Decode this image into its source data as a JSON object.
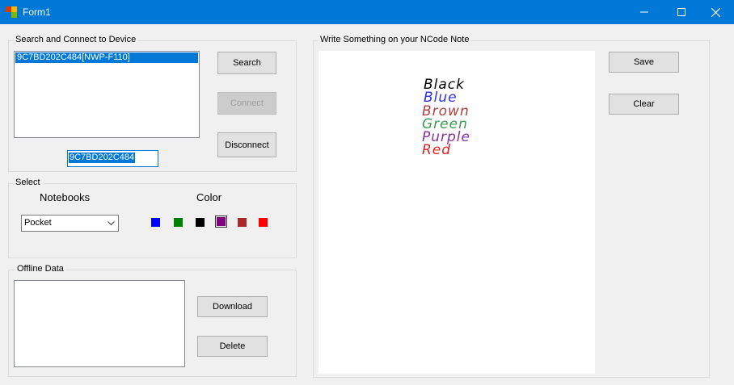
{
  "window": {
    "title": "Form1"
  },
  "search_group": {
    "label": "Search and Connect to Device",
    "devices": [
      "9C7BD202C484[NWP-F110]"
    ],
    "device_id_value": "9C7BD202C484",
    "search_label": "Search",
    "connect_label": "Connect",
    "disconnect_label": "Disconnect"
  },
  "select_group": {
    "label": "Select",
    "notebooks_label": "Notebooks",
    "color_label": "Color",
    "notebook_selected": "Pocket",
    "colors": [
      "#0000ff",
      "#008000",
      "#000000",
      "#800080",
      "#a52a2a",
      "#ff0000"
    ],
    "selected_color": "#800080"
  },
  "offline_group": {
    "label": "Offline Data",
    "download_label": "Download",
    "delete_label": "Delete"
  },
  "note_group": {
    "label": "Write Something on your NCode Note",
    "save_label": "Save",
    "clear_label": "Clear",
    "strokes": [
      {
        "text": "Black",
        "color": "#000000"
      },
      {
        "text": "Blue",
        "color": "#3030e0"
      },
      {
        "text": "Brown",
        "color": "#b04040"
      },
      {
        "text": "Green",
        "color": "#3a9a50"
      },
      {
        "text": "Purple",
        "color": "#8a30a0"
      },
      {
        "text": "Red",
        "color": "#e02020"
      }
    ]
  }
}
